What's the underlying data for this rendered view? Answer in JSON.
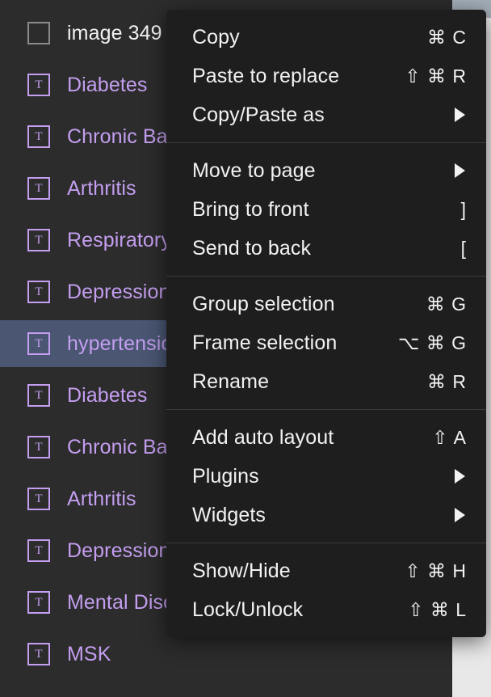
{
  "app": {
    "theme_background": "#2c2c2c",
    "menu_background": "#1e1e1e",
    "selection_color": "#4a5672",
    "text_layer_color": "#c49ef0"
  },
  "layers_panel": {
    "partial_top_row": {
      "icon": "frame-icon",
      "label": ""
    },
    "items": [
      {
        "icon": "image-icon",
        "label": "image 349",
        "type": "image",
        "selected": false
      },
      {
        "icon": "text-icon",
        "label": "Diabetes",
        "type": "text",
        "selected": false
      },
      {
        "icon": "text-icon",
        "label": "Chronic Back Pain",
        "type": "text",
        "selected": false
      },
      {
        "icon": "text-icon",
        "label": "Arthritis",
        "type": "text",
        "selected": false
      },
      {
        "icon": "text-icon",
        "label": "Respiratory",
        "type": "text",
        "selected": false
      },
      {
        "icon": "text-icon",
        "label": "Depression",
        "type": "text",
        "selected": false
      },
      {
        "icon": "text-icon",
        "label": "hypertension",
        "type": "text",
        "selected": true
      },
      {
        "icon": "text-icon",
        "label": "Diabetes",
        "type": "text",
        "selected": false
      },
      {
        "icon": "text-icon",
        "label": "Chronic Back Pain",
        "type": "text",
        "selected": false
      },
      {
        "icon": "text-icon",
        "label": "Arthritis",
        "type": "text",
        "selected": false
      },
      {
        "icon": "text-icon",
        "label": "Depression",
        "type": "text",
        "selected": false
      },
      {
        "icon": "text-icon",
        "label": "Mental Disorder",
        "type": "text",
        "selected": false
      },
      {
        "icon": "text-icon",
        "label": "MSK",
        "type": "text",
        "selected": false
      }
    ]
  },
  "context_menu": {
    "groups": [
      {
        "items": [
          {
            "label": "Copy",
            "shortcut": "⌘ C",
            "submenu": false
          },
          {
            "label": "Paste to replace",
            "shortcut": "⇧ ⌘ R",
            "submenu": false
          },
          {
            "label": "Copy/Paste as",
            "shortcut": "",
            "submenu": true
          }
        ]
      },
      {
        "items": [
          {
            "label": "Move to page",
            "shortcut": "",
            "submenu": true
          },
          {
            "label": "Bring to front",
            "shortcut": "]",
            "submenu": false
          },
          {
            "label": "Send to back",
            "shortcut": "[",
            "submenu": false
          }
        ]
      },
      {
        "items": [
          {
            "label": "Group selection",
            "shortcut": "⌘ G",
            "submenu": false
          },
          {
            "label": "Frame selection",
            "shortcut": "⌥ ⌘ G",
            "submenu": false
          },
          {
            "label": "Rename",
            "shortcut": "⌘ R",
            "submenu": false
          }
        ]
      },
      {
        "items": [
          {
            "label": "Add auto layout",
            "shortcut": "⇧ A",
            "submenu": false
          },
          {
            "label": "Plugins",
            "shortcut": "",
            "submenu": true
          },
          {
            "label": "Widgets",
            "shortcut": "",
            "submenu": true
          }
        ]
      },
      {
        "items": [
          {
            "label": "Show/Hide",
            "shortcut": "⇧ ⌘ H",
            "submenu": false
          },
          {
            "label": "Lock/Unlock",
            "shortcut": "⇧ ⌘ L",
            "submenu": false
          }
        ]
      }
    ]
  }
}
